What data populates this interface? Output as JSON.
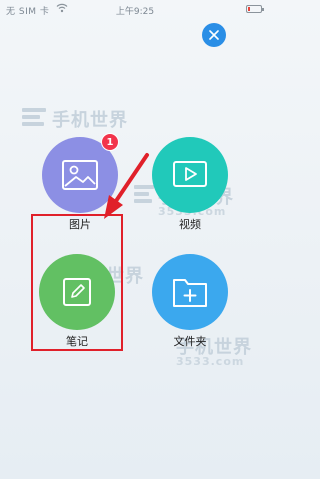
{
  "status_bar": {
    "carrier": "无 SIM 卡",
    "time": "上午9:25",
    "icons": [
      "wifi-icon",
      "battery-icon"
    ]
  },
  "watermark": {
    "brand": "手机世界",
    "sub": "3533.com"
  },
  "menu": {
    "items": [
      {
        "id": "pictures",
        "label": "图片",
        "icon": "image-icon",
        "color": "#8c8fe4",
        "badge": "1"
      },
      {
        "id": "video",
        "label": "视频",
        "icon": "play-icon",
        "color": "#21c9ba"
      },
      {
        "id": "notes",
        "label": "笔记",
        "icon": "pencil-icon",
        "color": "#62c063"
      },
      {
        "id": "folder",
        "label": "文件夹",
        "icon": "folder-plus-icon",
        "color": "#3ba8ee"
      }
    ]
  },
  "colors": {
    "close_button": "#2a8ee6",
    "badge": "#f2344b",
    "highlight": "#e0202a"
  }
}
